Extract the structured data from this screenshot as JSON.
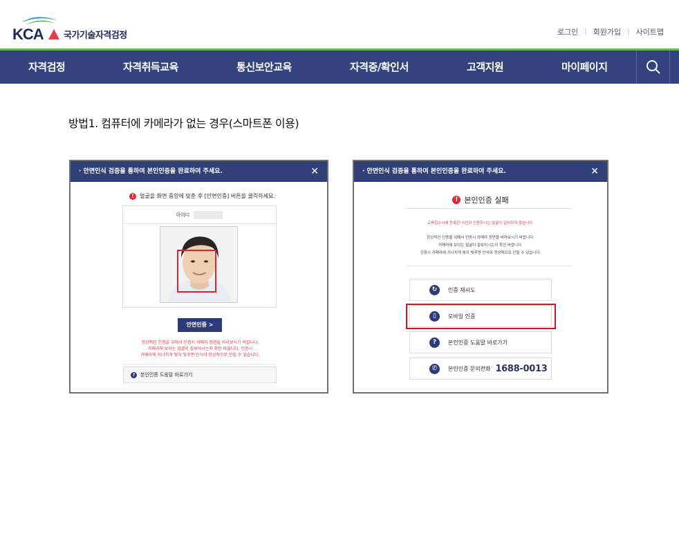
{
  "header": {
    "logo_letters": "KCA",
    "logo_name": "국가기술자격검정",
    "util_links": [
      "로그인",
      "회원가입",
      "사이트맵"
    ]
  },
  "nav": {
    "items": [
      "자격검정",
      "자격취득교육",
      "통신보안교육",
      "자격증/확인서",
      "고객지원",
      "마이페이지"
    ],
    "search_icon": "search-icon"
  },
  "content": {
    "method_title": "방법1. 컴퓨터에 카메라가 없는 경우(스마트폰 이용)"
  },
  "left_shot": {
    "bar_title": "· 안면인식 검증을 통하여 본인인증을 완료하여 주세요.",
    "close": "✕",
    "notice": "얼굴을 화면 중앙에 맞춘 후 [안면인증] 버튼을 클릭하세요.",
    "id_label": "아이디",
    "id_value": "",
    "verify_button": "안면인증 >",
    "warn_lines": [
      "정상적인 인증을 위해서 인증시 카메라 정면을 바라보시기 바랍니다.",
      "카메라에 보이는 얼굴이 잘보이시는지 확인 바랍니다. 인증시",
      "카메라에 지나치게 빛이 빛추면 인식이 정상적으로 안될 수 있습니다."
    ],
    "help_link": "본인인증 도움말 바로가기"
  },
  "right_shot": {
    "bar_title": "· 안면인식 검증을 통하여 본인인증을 완료하여 주세요.",
    "close": "✕",
    "fail_title": "본인인증 실패",
    "fail_red": "교육접수시에 등록한 사진과 인증하시는 얼굴이 일치하지 않습니다.",
    "fail_desc": [
      "정상적인 인증을 위해서 인증시 카메라 정면을 바라보시기 바랍니다.",
      "카메라에 보이는 얼굴이 잘보이시는지 확인 바랍니다.",
      "인증시 카메라에 지나치게 빛이 빛추면 인식이 정상적으로 안될 수 있습니다."
    ],
    "options": [
      {
        "label": "인증 재시도",
        "icon": "retry-icon"
      },
      {
        "label": "모바일 인증",
        "icon": "mobile-icon"
      },
      {
        "label": "본인인증 도움말 바로가기",
        "icon": "question-icon"
      },
      {
        "label": "본인인증 문의전화",
        "icon": "phone-icon",
        "phone": "1688-0013"
      }
    ]
  },
  "colors": {
    "nav_bg": "#34427e",
    "accent_green": "#6abf4b",
    "alert_red": "#e0283a",
    "highlight_red": "#d9121f"
  }
}
